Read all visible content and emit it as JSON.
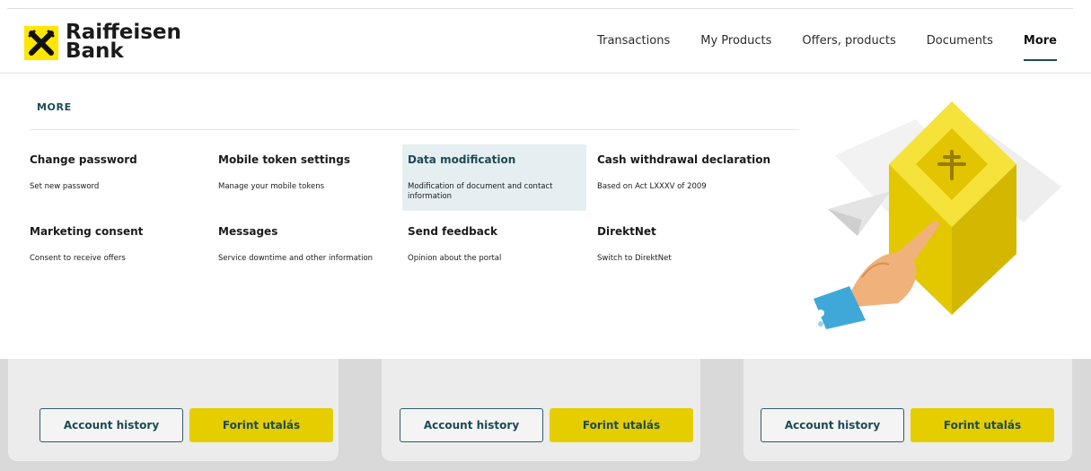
{
  "brand": {
    "line1": "Raiffeisen",
    "line2": "Bank",
    "color": "#fee600"
  },
  "nav": {
    "items": [
      {
        "label": "Transactions",
        "active": false
      },
      {
        "label": "My Products",
        "active": false
      },
      {
        "label": "Offers, products",
        "active": false
      },
      {
        "label": "Documents",
        "active": false
      },
      {
        "label": "More",
        "active": true
      }
    ]
  },
  "menu": {
    "title": "MORE",
    "items": [
      {
        "title": "Change password",
        "desc": "Set new password"
      },
      {
        "title": "Mobile token settings",
        "desc": "Manage your mobile tokens"
      },
      {
        "title": "Data modification",
        "desc": "Modification of document and contact information",
        "highlighted": true
      },
      {
        "title": "Cash withdrawal declaration",
        "desc": "Based on Act LXXXV of 2009"
      },
      {
        "title": "Marketing consent",
        "desc": "Consent to receive offers"
      },
      {
        "title": "Messages",
        "desc": "Service downtime and other information"
      },
      {
        "title": "Send feedback",
        "desc": "Opinion about the portal"
      },
      {
        "title": "DirektNet",
        "desc": "Switch to DirektNet"
      }
    ]
  },
  "cards": [
    {
      "history_label": "Account history",
      "transfer_label": "Forint utalás"
    },
    {
      "history_label": "Account history",
      "transfer_label": "Forint utalás"
    },
    {
      "history_label": "Account history",
      "transfer_label": "Forint utalás"
    }
  ],
  "colors": {
    "accent": "#1c4a55",
    "brand_yellow": "#fee600",
    "button_yellow": "#e5cd00",
    "highlight_bg": "#e5eff1"
  },
  "icons": {
    "logo": "raiffeisen-cross-icon",
    "illustration": "yellow-box-with-hand-illustration"
  }
}
